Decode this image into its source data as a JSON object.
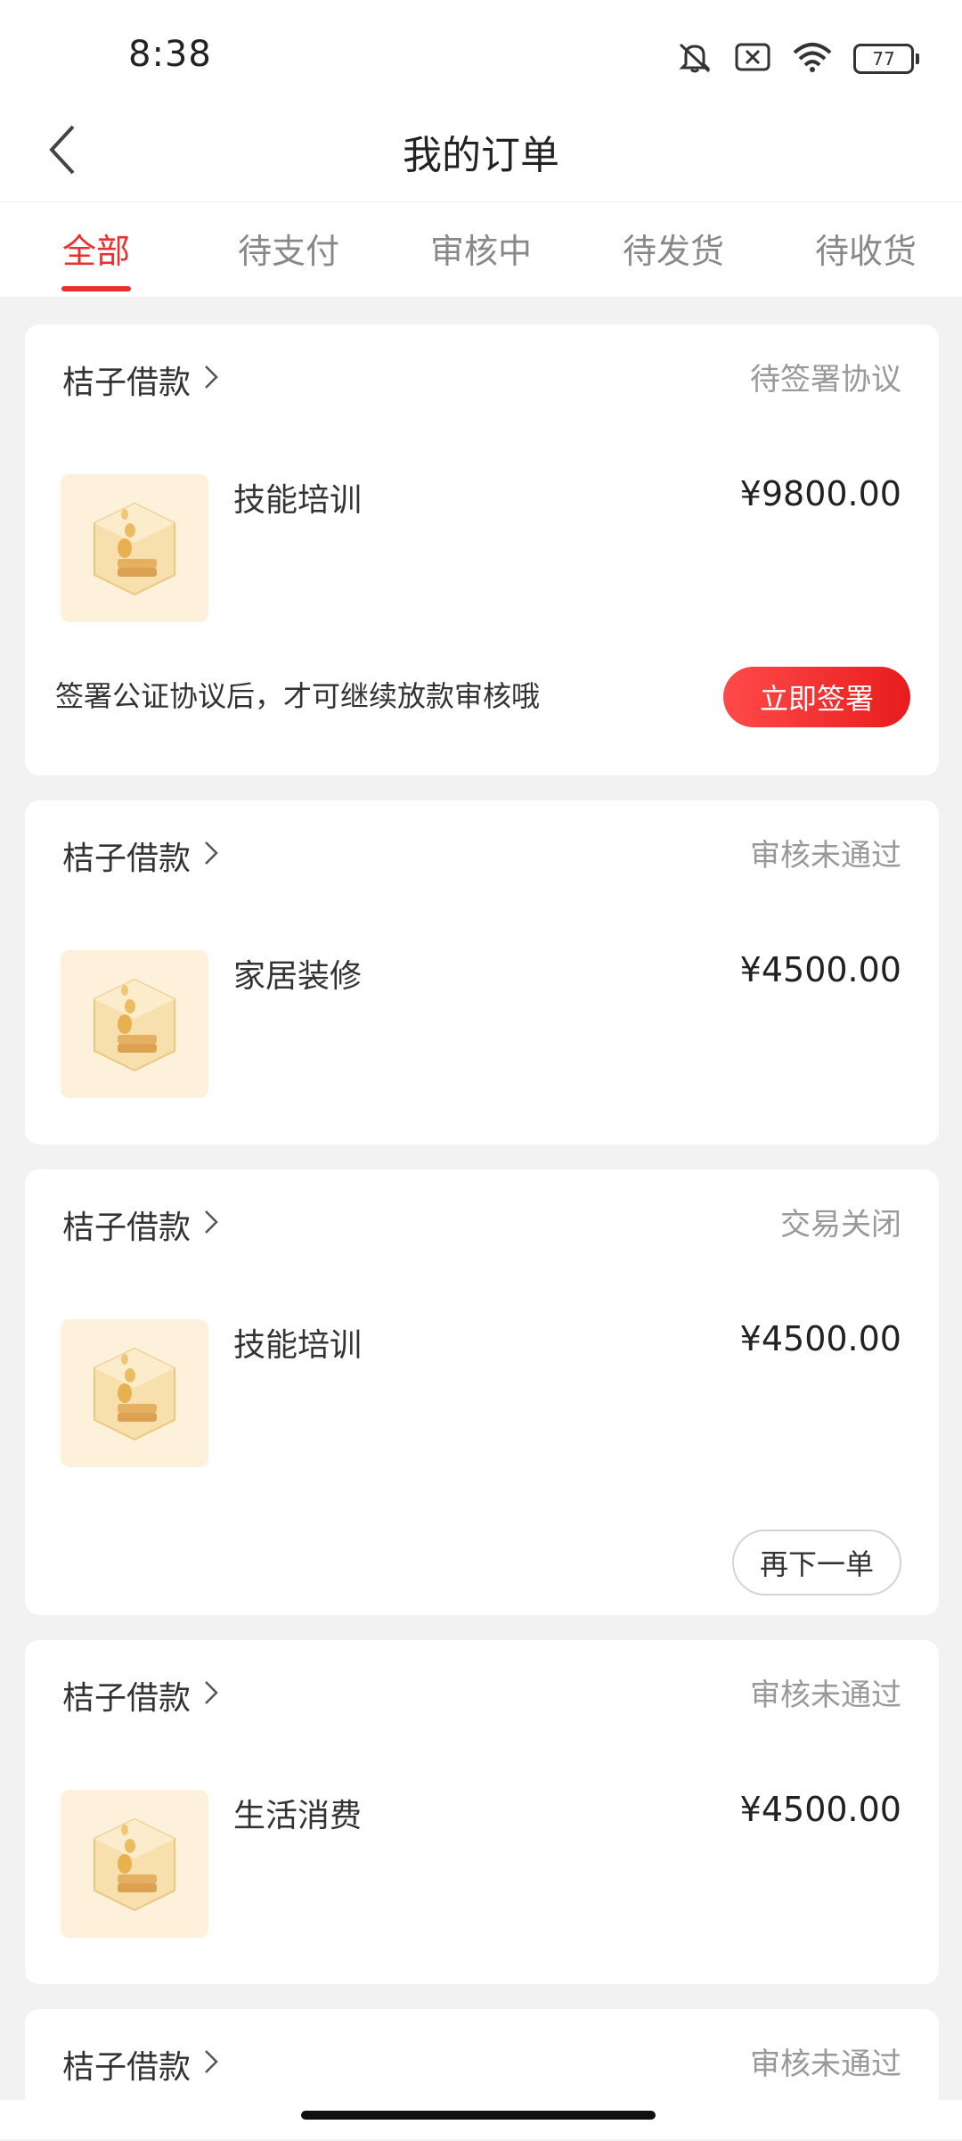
{
  "statusbar": {
    "time": "8:38",
    "battery": "77"
  },
  "header": {
    "title": "我的订单"
  },
  "tabs": [
    {
      "label": "全部",
      "active": true
    },
    {
      "label": "待支付",
      "active": false
    },
    {
      "label": "审核中",
      "active": false
    },
    {
      "label": "待发货",
      "active": false
    },
    {
      "label": "待收货",
      "active": false
    }
  ],
  "orders": [
    {
      "merchant": "桔子借款",
      "status": "待签署协议",
      "product": "技能培训",
      "price": "¥9800.00",
      "tip": "签署公证协议后，才可继续放款审核哦",
      "action": "立即签署"
    },
    {
      "merchant": "桔子借款",
      "status": "审核未通过",
      "product": "家居装修",
      "price": "¥4500.00"
    },
    {
      "merchant": "桔子借款",
      "status": "交易关闭",
      "product": "技能培训",
      "price": "¥4500.00",
      "action": "再下一单"
    },
    {
      "merchant": "桔子借款",
      "status": "审核未通过",
      "product": "生活消费",
      "price": "¥4500.00"
    },
    {
      "merchant": "桔子借款",
      "status": "审核未通过"
    }
  ],
  "colors": {
    "accent": "#e8302e",
    "background": "#f2f2f2",
    "thumb_bg": "#fdf1dc"
  },
  "icons": [
    "back-icon",
    "mute-icon",
    "sim-off-icon",
    "wifi-icon",
    "battery-icon",
    "chevron-right-icon",
    "coin-box-icon"
  ]
}
